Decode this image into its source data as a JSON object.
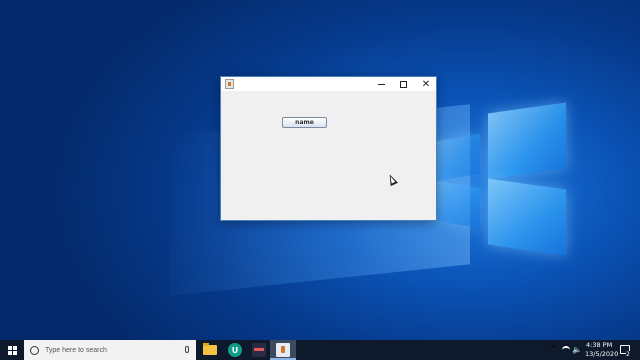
{
  "window": {
    "button_label": "name",
    "controls": {
      "minimize": "minimize",
      "maximize": "maximize",
      "close": "✕"
    }
  },
  "taskbar": {
    "search_placeholder": "Type here to search",
    "pinned_icons": [
      "file-explorer-icon",
      "app-circle-icon",
      "app-dark-icon",
      "java-icon"
    ],
    "app_circle_glyph": "U",
    "tray": {
      "chevron": "^",
      "volume": "🔈",
      "time": "4:38 PM",
      "date": "13/5/2020",
      "notifications": "2"
    }
  },
  "colors": {
    "desktop": "#0b54b8",
    "taskbar": "#0e1a2b",
    "window_bg": "#f0f0f0"
  }
}
